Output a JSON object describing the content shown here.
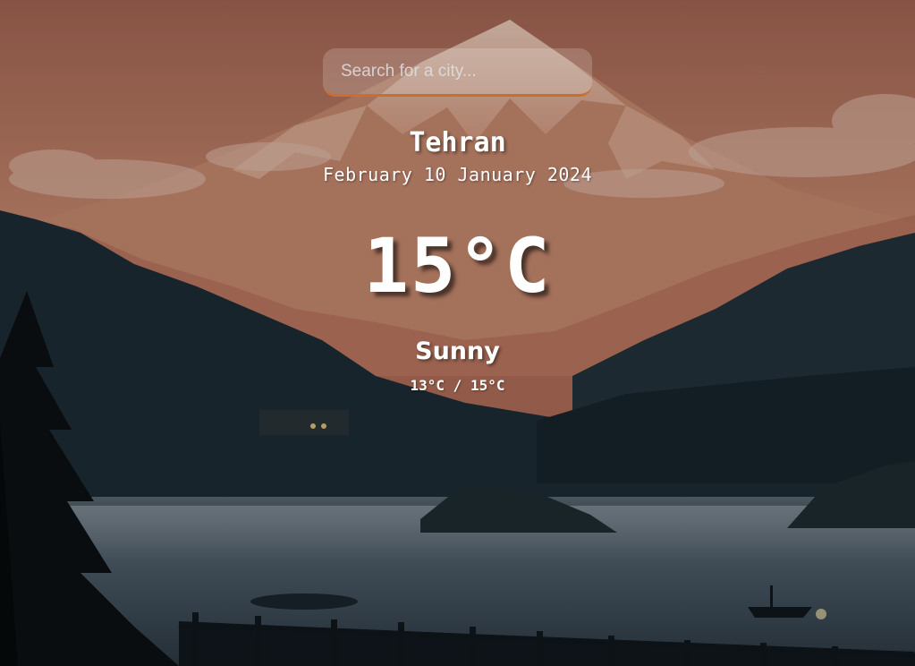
{
  "search": {
    "placeholder": "Search for a city...",
    "accent_color": "#c96f2e"
  },
  "weather": {
    "city": "Tehran",
    "date": "February 10 January 2024",
    "temperature": "15°C",
    "condition": "Sunny",
    "range": "13°C / 15°C"
  },
  "background": {
    "scene": "sunset mountain lake landscape with moon, forest silhouettes, fence and boat",
    "sky_top_color": "#b0705b",
    "mountain_color": "#cf8d72",
    "forest_color": "#1a2a33",
    "lake_color": "#3b4b58"
  }
}
